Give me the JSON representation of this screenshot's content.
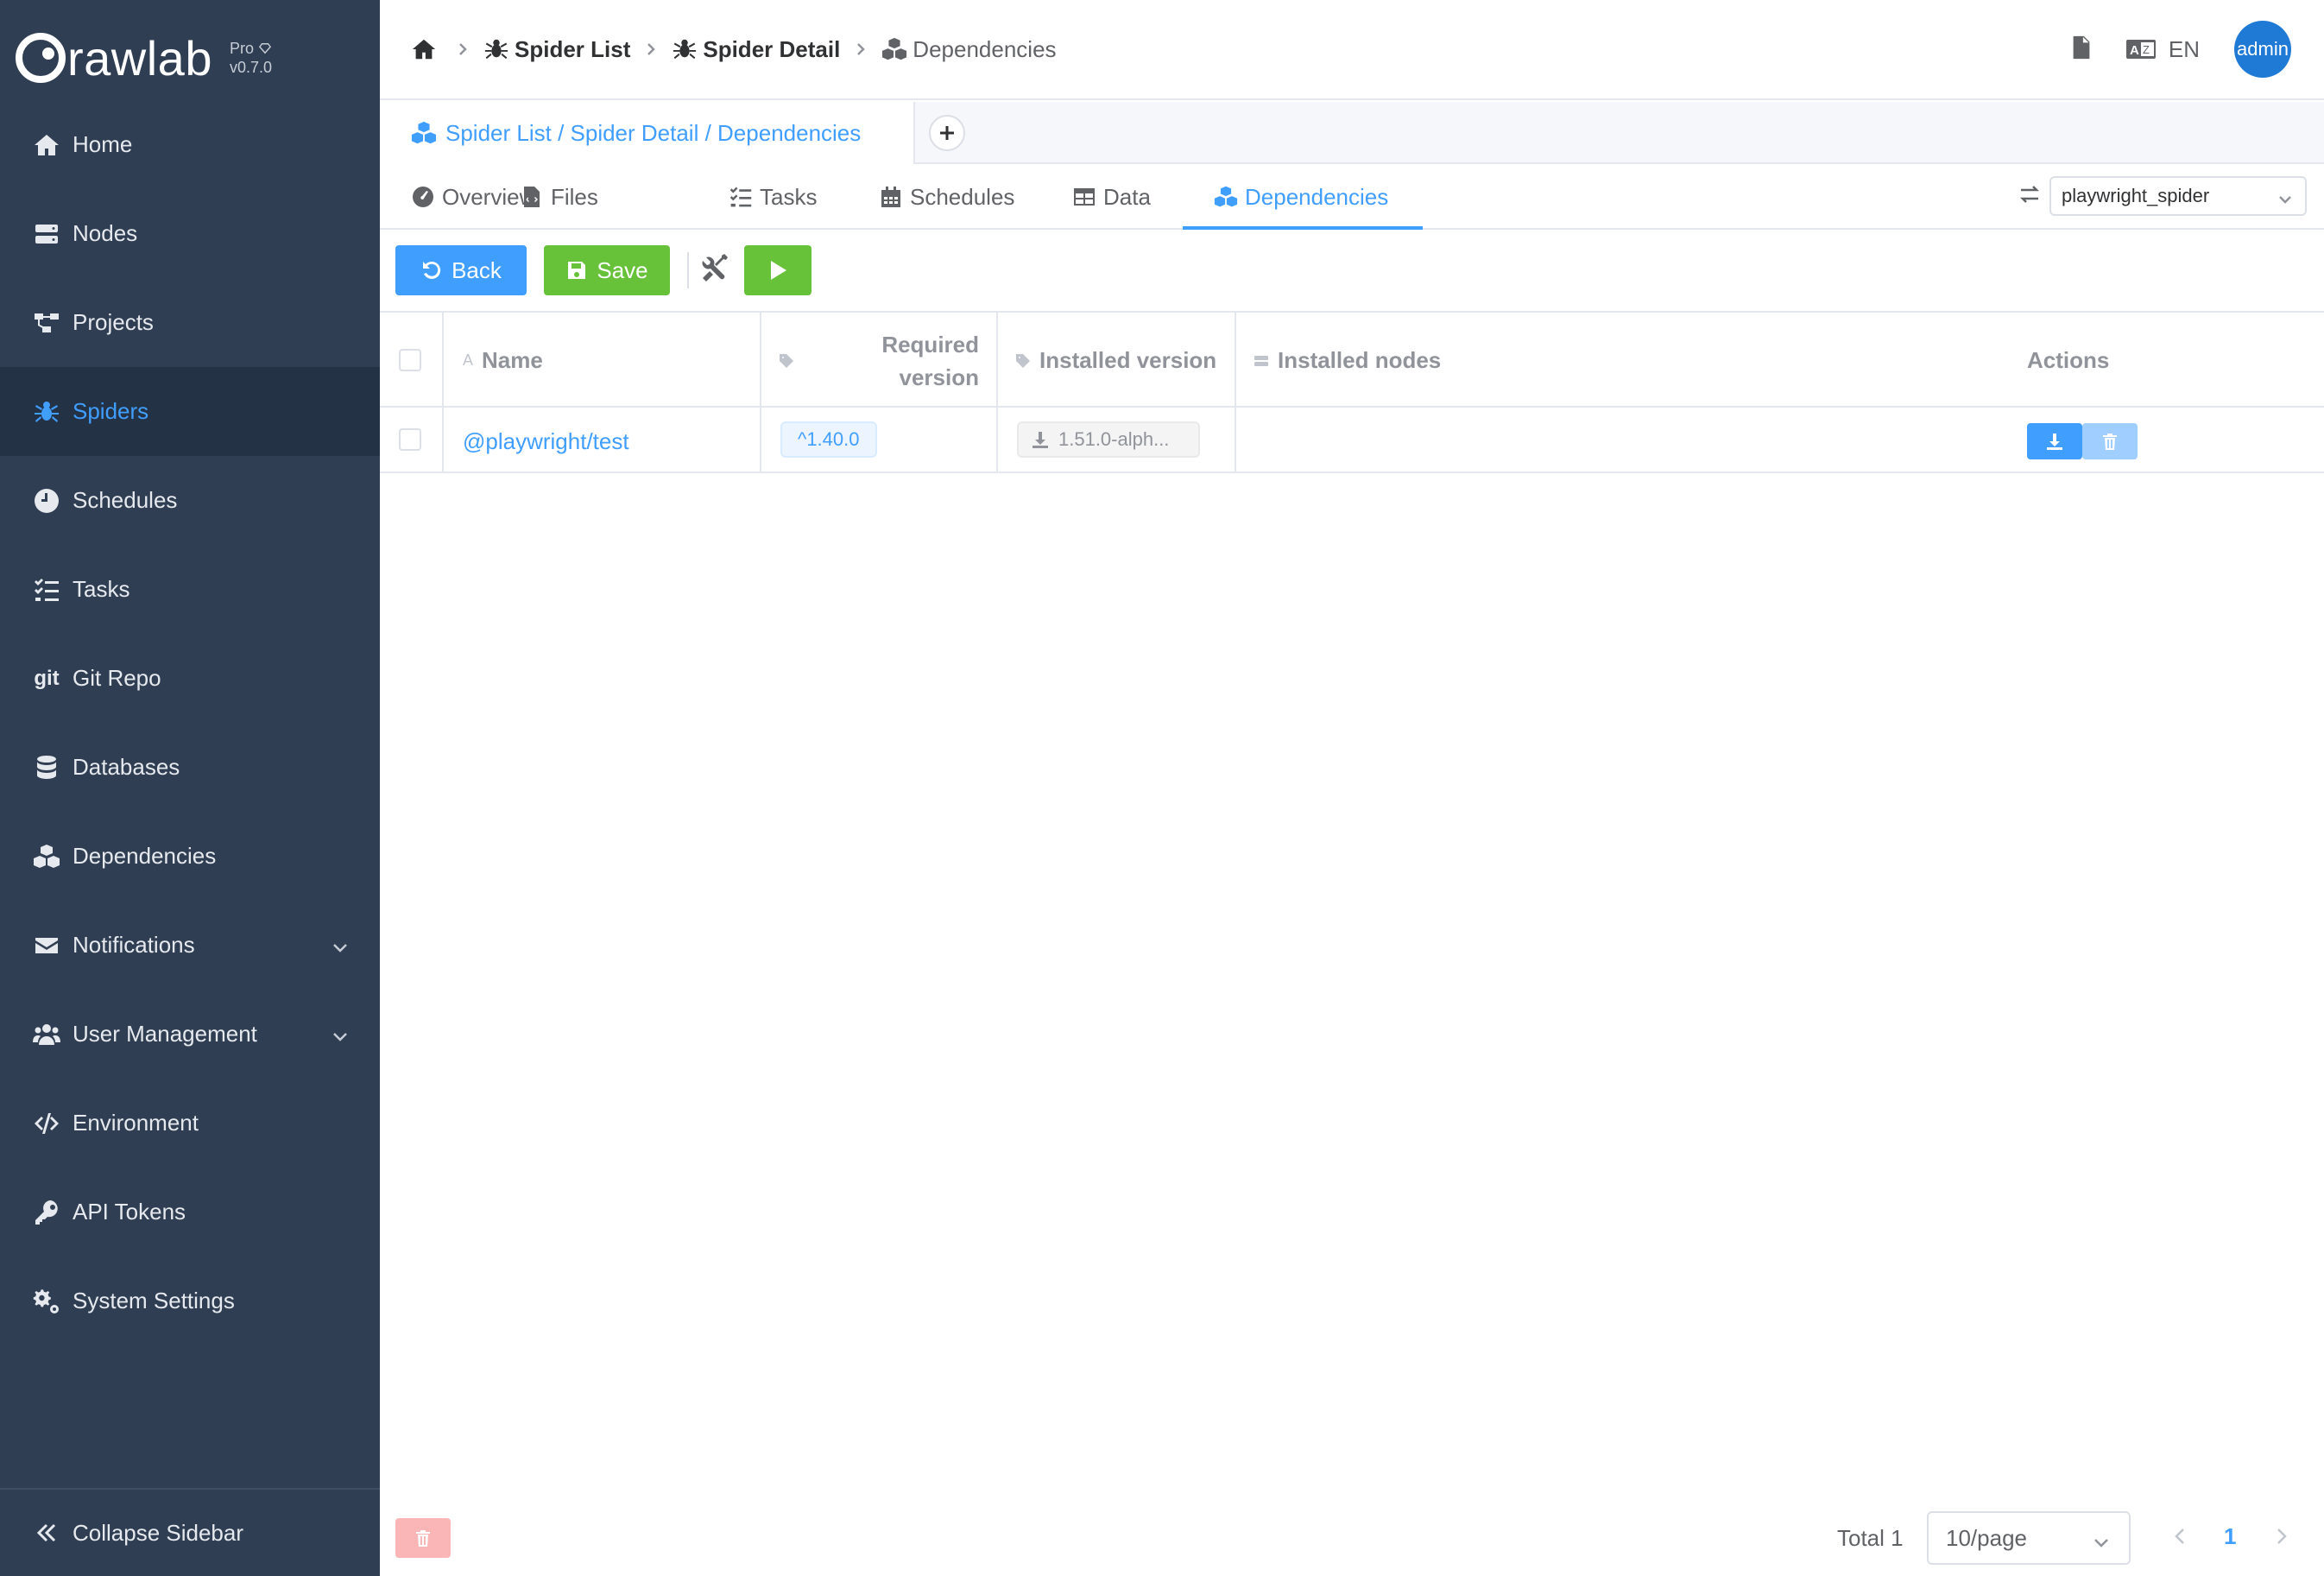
{
  "app": {
    "logo_text": "rawlab",
    "edition": "Pro",
    "version": "v0.7.0"
  },
  "sidebar": {
    "items": [
      {
        "label": "Home",
        "icon": "home-icon"
      },
      {
        "label": "Nodes",
        "icon": "server-icon"
      },
      {
        "label": "Projects",
        "icon": "project-diagram-icon"
      },
      {
        "label": "Spiders",
        "icon": "spider-icon",
        "active": true
      },
      {
        "label": "Schedules",
        "icon": "clock-icon"
      },
      {
        "label": "Tasks",
        "icon": "tasks-icon"
      },
      {
        "label": "Git Repo",
        "icon": "git-icon"
      },
      {
        "label": "Databases",
        "icon": "database-icon"
      },
      {
        "label": "Dependencies",
        "icon": "cubes-icon"
      },
      {
        "label": "Notifications",
        "icon": "envelope-icon",
        "expandable": true
      },
      {
        "label": "User Management",
        "icon": "users-icon",
        "expandable": true
      },
      {
        "label": "Environment",
        "icon": "code-icon"
      },
      {
        "label": "API Tokens",
        "icon": "key-icon"
      },
      {
        "label": "System Settings",
        "icon": "cogs-icon"
      }
    ],
    "collapse_label": "Collapse Sidebar"
  },
  "header": {
    "breadcrumb": [
      "Spider List",
      "Spider Detail",
      "Dependencies"
    ],
    "language": "EN",
    "user": "admin"
  },
  "tabbar": {
    "active_tab": "Spider List / Spider Detail / Dependencies"
  },
  "navtabs": {
    "items": [
      "Overview",
      "Files",
      "Tasks",
      "Schedules",
      "Data",
      "Dependencies"
    ],
    "active": "Dependencies",
    "selected_spider": "playwright_spider"
  },
  "toolbar": {
    "back_label": "Back",
    "save_label": "Save"
  },
  "table": {
    "headers": {
      "name": "Name",
      "required_version_line1": "Required",
      "required_version_line2": "version",
      "installed_version": "Installed version",
      "installed_nodes": "Installed nodes",
      "actions": "Actions"
    },
    "rows": [
      {
        "name": "@playwright/test",
        "required_version": "^1.40.0",
        "installed_version": "1.51.0-alph...",
        "installed_nodes": ""
      }
    ]
  },
  "pagination": {
    "total_label": "Total 1",
    "page_size": "10/page",
    "current_page": "1"
  },
  "colors": {
    "sidebar_bg": "#2f3e52",
    "primary": "#409eff",
    "success": "#67c23a"
  }
}
